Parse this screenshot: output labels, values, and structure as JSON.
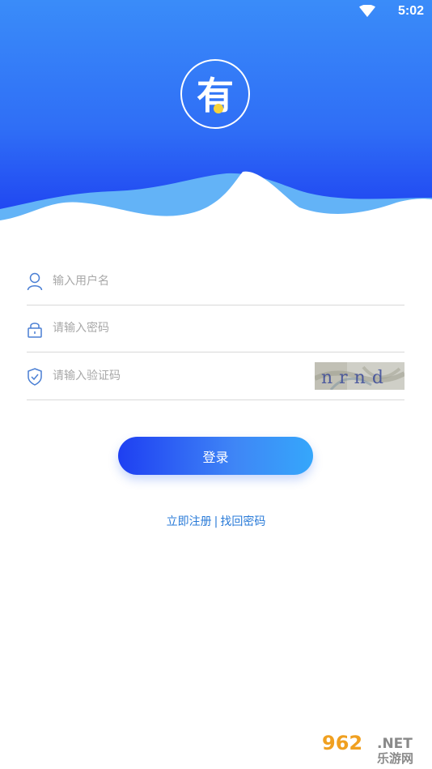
{
  "status_bar": {
    "time": "5:02",
    "wifi_icon": "wifi-icon"
  },
  "colors": {
    "header_top": "#3a8cf9",
    "header_bottom": "#1c3bf0",
    "wave_light": "#63b3f7",
    "link": "#2a7bd8",
    "button_start": "#1e3ff2",
    "button_end": "#35a7fb"
  },
  "logo": {
    "text": "有"
  },
  "form": {
    "username": {
      "placeholder": "输入用户名",
      "value": "",
      "icon": "user-icon"
    },
    "password": {
      "placeholder": "请输入密码",
      "value": "",
      "icon": "lock-icon"
    },
    "verification": {
      "placeholder": "请输入验证码",
      "value": "",
      "icon": "shield-check-icon"
    },
    "captcha_text": "nrnd"
  },
  "login_button": "登录",
  "links": {
    "register": "立即注册",
    "separator": "|",
    "forgot_password": "找回密码"
  },
  "watermark": {
    "number": "962",
    "domain": ".NET",
    "site_name": "乐游网"
  }
}
